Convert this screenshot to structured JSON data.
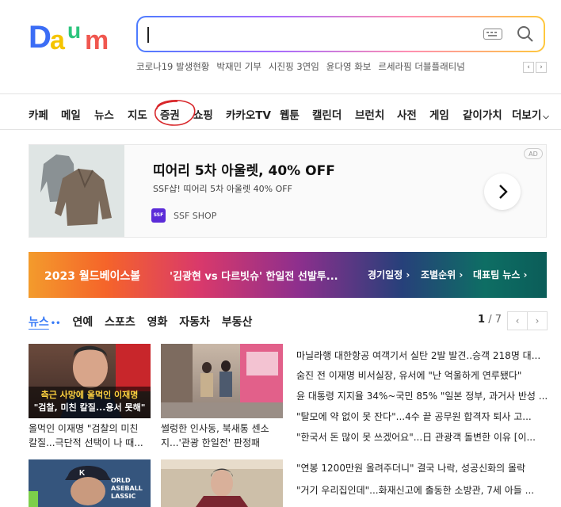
{
  "header": {
    "logo_text": "Daum",
    "trending": [
      "코로나19 발생현황",
      "박재민 기부",
      "시진핑 3연임",
      "윤다영 화보",
      "르세라핌 더블플래티넘"
    ],
    "trending_prev": "‹",
    "trending_next": "›"
  },
  "nav": {
    "items": [
      "카페",
      "메일",
      "뉴스",
      "지도",
      "증권",
      "쇼핑",
      "카카오TV",
      "웹툰",
      "캘린더",
      "브런치",
      "사전",
      "게임",
      "같이가치",
      "더보기"
    ]
  },
  "ad": {
    "title": "띠어리 5차 아울렛, 40% OFF",
    "subtitle": "SSF샵! 띠어리 5차 아울렛 40% OFF",
    "brand_logo": "SSF",
    "brand": "SSF SHOP",
    "badge": "AD"
  },
  "banner": {
    "brand": "2023 월드베이스볼",
    "headline": "'김광현 vs 다르빗슈' 한일전 선발투...",
    "links": [
      "경기일정 ›",
      "조별순위 ›",
      "대표팀 뉴스 ›"
    ]
  },
  "news": {
    "tabs": [
      "뉴스",
      "연예",
      "스포츠",
      "영화",
      "자동차",
      "부동산"
    ],
    "page_current": "1",
    "page_total": "/ 7",
    "cards": [
      {
        "line1": "올먹인 이재명 \"검찰의 미친",
        "line2": "칼질...극단적 선택이 나 때...",
        "overlay1": "측근 사망에 울먹인 이재명",
        "overlay2": "\"검찰, 미친 칼질...용서 못해\""
      },
      {
        "line1": "썰렁한 인사동, 북새통 센소",
        "line2": "지...'관광 한일전' 판정패"
      }
    ],
    "headlines": [
      "마닐라행 대한항공 여객기서 실탄 2발 발견..승객 218명 대...",
      "숨진 전 이재명 비서실장, 유서에 \"난 억울하게 연루됐다\"",
      "윤 대통령 지지율 34%~국민 85% \"일본 정부, 과거사 반성 ...",
      "\"탈모에 약 없이 못 잔다\"...4수 끝 공무원 합격자 퇴사 고...",
      "\"한국서 돈 많이 못 쓰겠어요\"...日 관광객 돌변한 이유 [이...",
      "\"연봉 1200만원 올려주더니\" 결국 나락, 성공신화의 몰락",
      "\"거기 우리집인데\"...화재신고에 출동한 소방관, 7세 아들 ..."
    ],
    "bottom_overlay": "ORLD ASEBALL LASSIC"
  }
}
